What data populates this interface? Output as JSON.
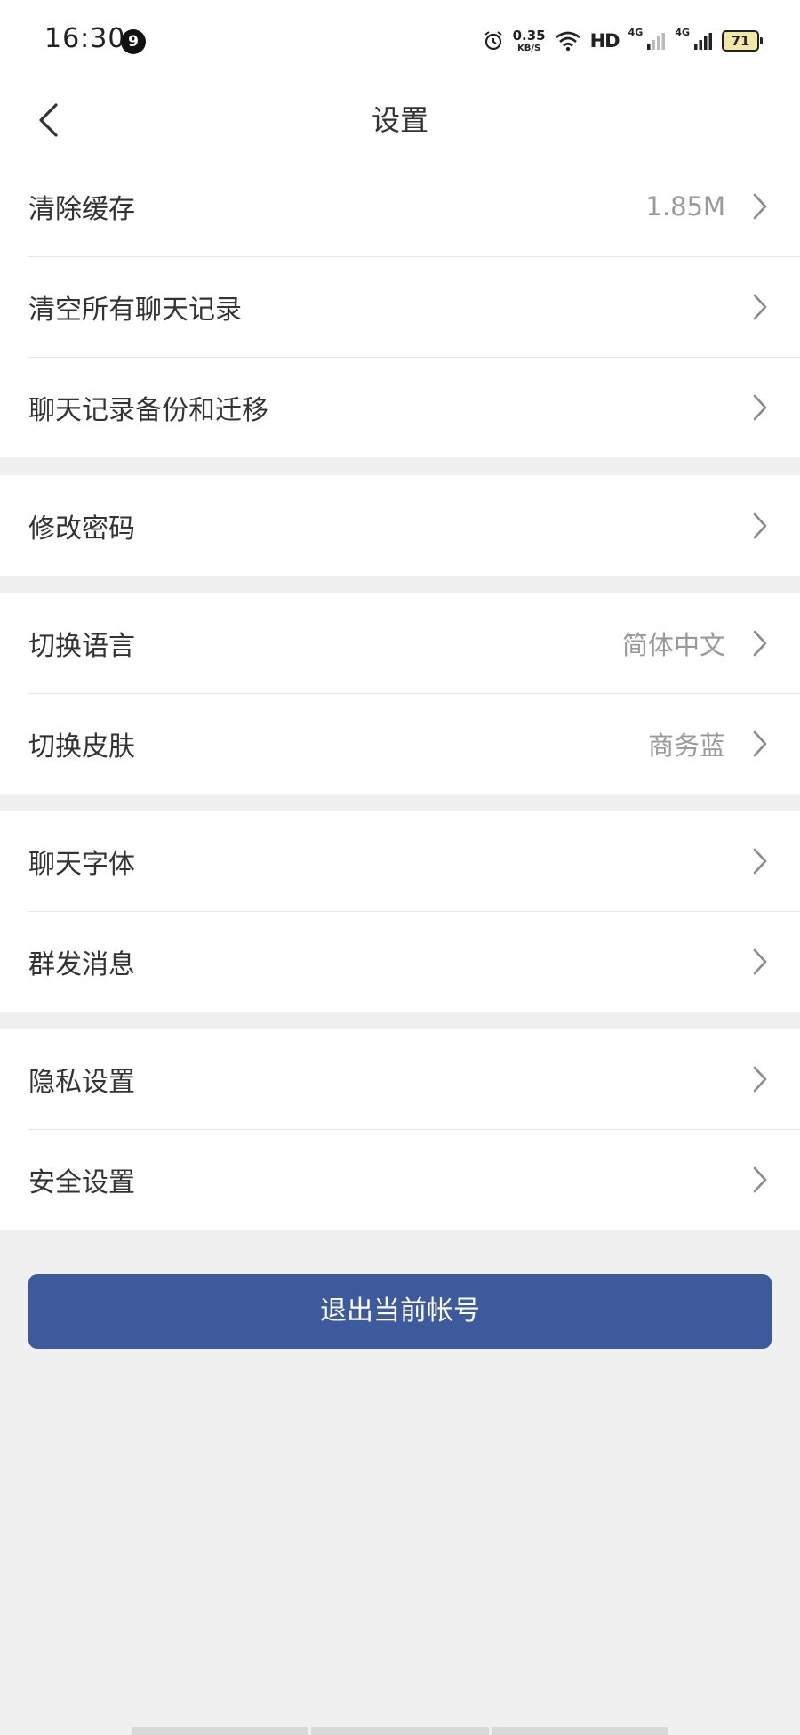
{
  "status_bar": {
    "time": "16:30",
    "notification_count": "9",
    "net_speed_value": "0.35",
    "net_speed_unit": "KB/S",
    "hd_label": "HD",
    "signal1_label": "4G",
    "signal2_label": "4G",
    "battery": "71"
  },
  "header": {
    "title": "设置",
    "back_icon": "chevron-left-icon"
  },
  "groups": [
    {
      "items": [
        {
          "label": "清除缓存",
          "value": "1.85M"
        },
        {
          "label": "清空所有聊天记录",
          "value": ""
        },
        {
          "label": "聊天记录备份和迁移",
          "value": ""
        }
      ]
    },
    {
      "items": [
        {
          "label": "修改密码",
          "value": ""
        }
      ]
    },
    {
      "items": [
        {
          "label": "切换语言",
          "value": "简体中文"
        },
        {
          "label": "切换皮肤",
          "value": "商务蓝"
        }
      ]
    },
    {
      "items": [
        {
          "label": "聊天字体",
          "value": ""
        },
        {
          "label": "群发消息",
          "value": ""
        }
      ]
    },
    {
      "items": [
        {
          "label": "隐私设置",
          "value": ""
        },
        {
          "label": "安全设置",
          "value": ""
        }
      ]
    }
  ],
  "logout_label": "退出当前帐号",
  "colors": {
    "accent": "#3d5a9c",
    "background": "#f0f0f0",
    "value_text": "#999999"
  }
}
